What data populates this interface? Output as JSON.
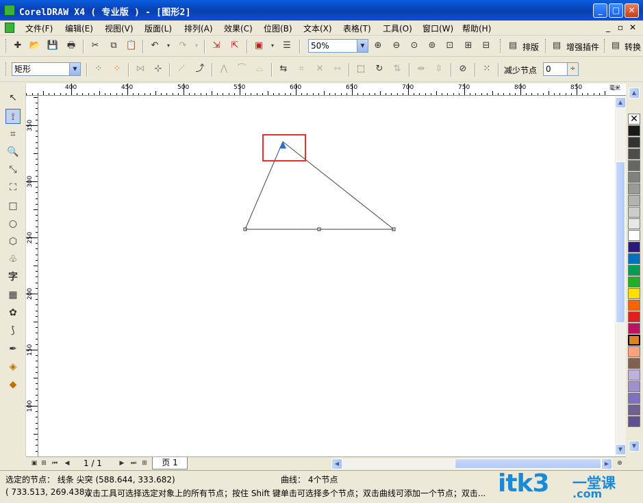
{
  "window": {
    "title": "CorelDRAW X4 ( 专业版 ) - [图形2]",
    "minimize_glyph": "_",
    "maximize_glyph": "□",
    "close_glyph": "✕"
  },
  "menu": {
    "items": [
      "文件(F)",
      "编辑(E)",
      "视图(V)",
      "版面(L)",
      "排列(A)",
      "效果(C)",
      "位图(B)",
      "文本(X)",
      "表格(T)",
      "工具(O)",
      "窗口(W)",
      "帮助(H)"
    ],
    "mdi_min": "_",
    "mdi_restore": "▫",
    "mdi_close": "✕"
  },
  "standard_toolbar": {
    "zoom_value": "50%",
    "layout_label": "排版",
    "plugin_label": "增强插件",
    "convert_label": "转换"
  },
  "property_bar": {
    "shape_select_value": "矩形",
    "reduce_nodes_label": "减少节点",
    "reduce_nodes_value": "0"
  },
  "ruler": {
    "unit": "毫米",
    "h_labels": [
      "400",
      "450",
      "500",
      "550",
      "600",
      "650",
      "700",
      "750",
      "800",
      "850"
    ],
    "v_labels": [
      "350",
      "300",
      "250",
      "200",
      "150",
      "100"
    ]
  },
  "drawing": {
    "shape": "triangle-curve",
    "nodes_count": 4,
    "highlight_color": "#e03030",
    "selected_node_color": "#2a6fd0"
  },
  "navigator": {
    "page_count": "1 / 1",
    "page_tab": "页 1"
  },
  "status": {
    "selected_node": "选定的节点： 线条 尖突 (588.644, 333.682)",
    "curve_info": "曲线： 4个节点",
    "cursor_coords": "( 733.513, 269.438 )",
    "hint": "双击工具可选择选定对象上的所有节点；按住 Shift 键单击可选择多个节点；双击曲线可添加一个节点；双击..."
  },
  "watermark": {
    "text": "itk3",
    "cn": "一堂课",
    "com": ".com"
  },
  "palette_colors": [
    "#ffffff",
    "#1a1a1a",
    "#333333",
    "#4d4d4d",
    "#666666",
    "#808080",
    "#999999",
    "#b3b3b3",
    "#cccccc",
    "#e6e6e6",
    "#ffffff",
    "#2a1a7a",
    "#0070c0",
    "#00a050",
    "#20b020",
    "#ffe000",
    "#ff6000",
    "#e02020",
    "#c01060",
    "#e08020",
    "#ffa080",
    "#806050",
    "#c0b0e0",
    "#a090d0",
    "#8070c0",
    "#706090",
    "#605090"
  ]
}
